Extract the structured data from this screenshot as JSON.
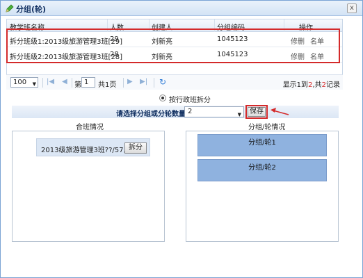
{
  "window": {
    "title": "分组(轮)",
    "close_glyph": "x"
  },
  "grid": {
    "columns": [
      "教学班名称",
      "人数",
      "创建人",
      "分组编码",
      "操作"
    ],
    "rows": [
      {
        "name": "拆分班级1:2013级旅游管理3班[29]",
        "count": "29",
        "creator": "刘新亮",
        "code": "1045123",
        "edit": "修删",
        "list": "名单"
      },
      {
        "name": "拆分班级2:2013级旅游管理3班[28]",
        "count": "28",
        "creator": "刘新亮",
        "code": "1045123",
        "edit": "修删",
        "list": "名单"
      }
    ]
  },
  "pager": {
    "page_size": "100",
    "page_prefix": "第",
    "page_value": "1",
    "page_suffix": "共1页",
    "info_prefix": "显示1到",
    "info_count": "2",
    "info_mid": ",共",
    "info_total": "2",
    "info_suffix": "记录"
  },
  "split_mode": {
    "label": "按行政班拆分",
    "checked": true
  },
  "group_select": {
    "label": "请选择分组或分轮数量:",
    "value": "2"
  },
  "save_button": "保存",
  "left_panel": {
    "title": "合班情况",
    "card_text": "2013级旅游管理3班??/57人",
    "split_button": "拆分"
  },
  "right_panel": {
    "title": "分组/轮情况",
    "groups": [
      "分组/轮1",
      "分组/轮2"
    ]
  },
  "colors": {
    "accent": "#8fb2df",
    "highlight": "#d42a2a",
    "title_text": "#0e2d5f"
  },
  "icons": [
    "pencil-icon",
    "close-icon",
    "first-page-icon",
    "prev-page-icon",
    "next-page-icon",
    "last-page-icon",
    "refresh-icon",
    "chevron-down-icon",
    "arrow-pointer-icon"
  ]
}
